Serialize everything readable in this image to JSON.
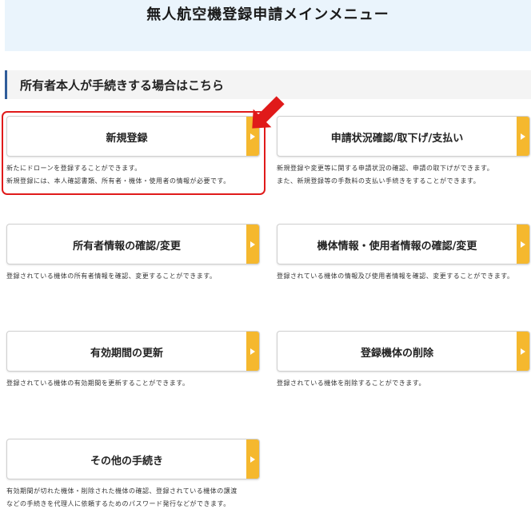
{
  "header": {
    "title": "無人航空機登録申請メインメニュー"
  },
  "section": {
    "heading": "所有者本人が手続きする場合はこちら"
  },
  "menu": {
    "new_registration": {
      "label": "新規登録",
      "desc": [
        "新たにドローンを登録することができます。",
        "新規登録には、本人確認書類、所有者・機体・使用者の情報が必要です。"
      ]
    },
    "status_check": {
      "label": "申請状況確認/取下げ/支払い",
      "desc": [
        "新規登録や変更等に関する申請状況の確認、申請の取下げができます。",
        "また、新規登録等の手数料の支払い手続きをすることができます。"
      ]
    },
    "owner_info": {
      "label": "所有者情報の確認/変更",
      "desc": [
        "登録されている機体の所有者情報を確認、変更することができます。"
      ]
    },
    "aircraft_info": {
      "label": "機体情報・使用者情報の確認/変更",
      "desc": [
        "登録されている機体の情報及び使用者情報を確認、変更することができます。"
      ]
    },
    "renewal": {
      "label": "有効期間の更新",
      "desc": [
        "登録されている機体の有効期間を更新することができます。"
      ]
    },
    "delete_aircraft": {
      "label": "登録機体の削除",
      "desc": [
        "登録されている機体を削除することができます。"
      ]
    },
    "other": {
      "label": "その他の手続き",
      "desc": [
        "有効期間が切れた機体・削除された機体の確認、登録されている機体の譲渡",
        "などの手続きを代理人に依頼するためのパスワード発行などができます。"
      ]
    }
  },
  "colors": {
    "header_bg": "#eaf4fc",
    "accent_tab": "#f5b82e",
    "highlight": "#e01a1a",
    "heading_bar": "#2f5c9a"
  }
}
